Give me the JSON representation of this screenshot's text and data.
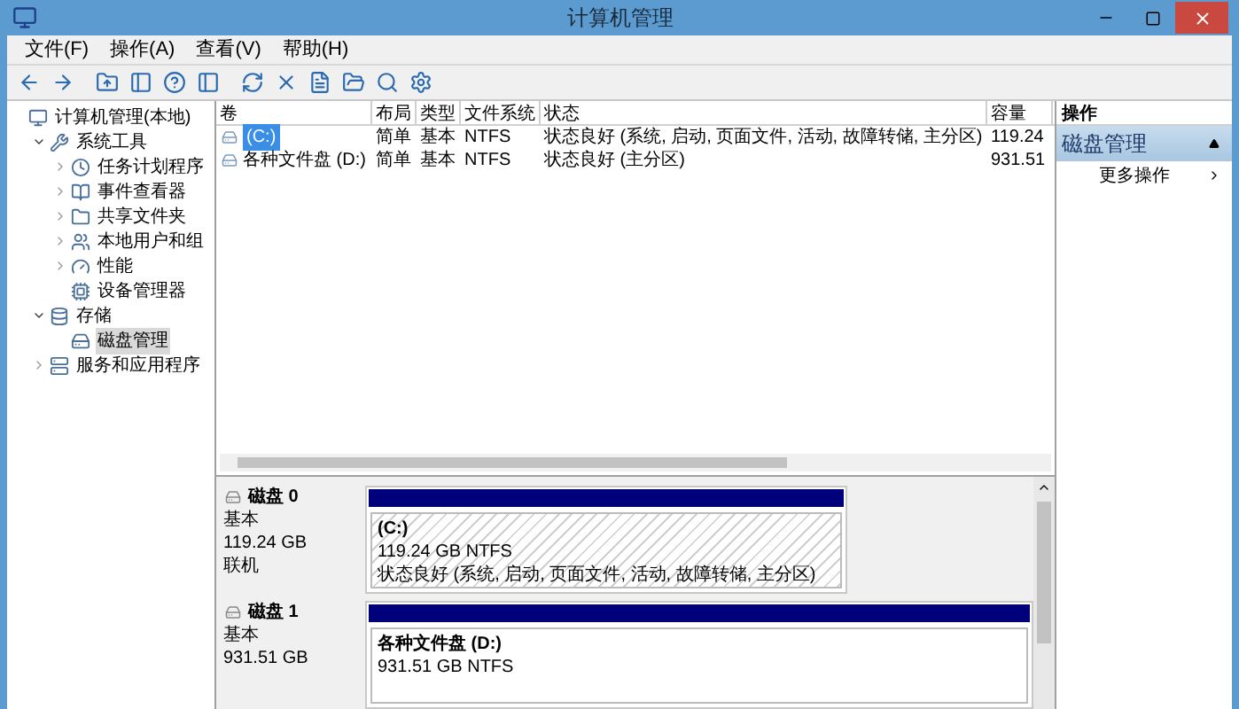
{
  "window": {
    "title": "计算机管理"
  },
  "menu": [
    "文件(F)",
    "操作(A)",
    "查看(V)",
    "帮助(H)"
  ],
  "tree": [
    {
      "label": "计算机管理(本地)",
      "selected": false,
      "children": [
        {
          "label": "系统工具",
          "selected": false,
          "expanded": true,
          "children": [
            {
              "label": "任务计划程序",
              "selected": false,
              "expanded": false
            },
            {
              "label": "事件查看器",
              "selected": false,
              "expanded": false
            },
            {
              "label": "共享文件夹",
              "selected": false,
              "expanded": false
            },
            {
              "label": "本地用户和组",
              "selected": false,
              "expanded": false
            },
            {
              "label": "性能",
              "selected": false,
              "expanded": false
            },
            {
              "label": "设备管理器",
              "selected": false
            }
          ]
        },
        {
          "label": "存储",
          "selected": false,
          "expanded": true,
          "children": [
            {
              "label": "磁盘管理",
              "selected": true
            }
          ]
        },
        {
          "label": "服务和应用程序",
          "selected": false,
          "expanded": false
        }
      ]
    }
  ],
  "table": {
    "columns": [
      "卷",
      "布局",
      "类型",
      "文件系统",
      "状态",
      "容量"
    ],
    "rows": [
      {
        "selected": true,
        "cells": [
          "(C:)",
          "简单",
          "基本",
          "NTFS",
          "状态良好 (系统, 启动, 页面文件, 活动, 故障转储, 主分区)",
          "119.24"
        ]
      },
      {
        "selected": false,
        "cells": [
          "各种文件盘 (D:)",
          "简单",
          "基本",
          "NTFS",
          "状态良好 (主分区)",
          "931.51"
        ]
      }
    ]
  },
  "disks": [
    {
      "name": "磁盘 0",
      "type": "基本",
      "size": "119.24 GB",
      "status": "联机",
      "partition": {
        "name": "(C:)",
        "size": "119.24 GB NTFS",
        "status": "状态良好 (系统, 启动, 页面文件, 活动, 故障转储, 主分区)",
        "selected": true
      }
    },
    {
      "name": "磁盘 1",
      "type": "基本",
      "size": "931.51 GB",
      "partition": {
        "name": "各种文件盘  (D:)",
        "size": "931.51 GB NTFS",
        "selected": false
      }
    }
  ],
  "actions": {
    "title": "操作",
    "section": "磁盘管理",
    "items": [
      "更多操作"
    ]
  }
}
